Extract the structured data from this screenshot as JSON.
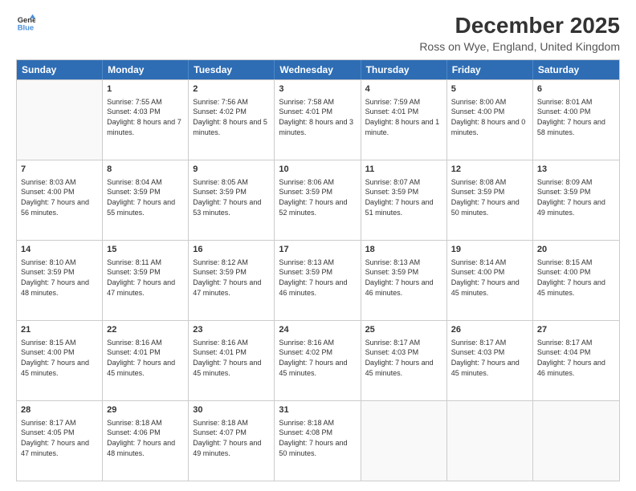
{
  "logo": {
    "line1": "General",
    "line2": "Blue"
  },
  "title": "December 2025",
  "subtitle": "Ross on Wye, England, United Kingdom",
  "header_days": [
    "Sunday",
    "Monday",
    "Tuesday",
    "Wednesday",
    "Thursday",
    "Friday",
    "Saturday"
  ],
  "weeks": [
    [
      {
        "day": "",
        "sunrise": "",
        "sunset": "",
        "daylight": ""
      },
      {
        "day": "1",
        "sunrise": "Sunrise: 7:55 AM",
        "sunset": "Sunset: 4:03 PM",
        "daylight": "Daylight: 8 hours and 7 minutes."
      },
      {
        "day": "2",
        "sunrise": "Sunrise: 7:56 AM",
        "sunset": "Sunset: 4:02 PM",
        "daylight": "Daylight: 8 hours and 5 minutes."
      },
      {
        "day": "3",
        "sunrise": "Sunrise: 7:58 AM",
        "sunset": "Sunset: 4:01 PM",
        "daylight": "Daylight: 8 hours and 3 minutes."
      },
      {
        "day": "4",
        "sunrise": "Sunrise: 7:59 AM",
        "sunset": "Sunset: 4:01 PM",
        "daylight": "Daylight: 8 hours and 1 minute."
      },
      {
        "day": "5",
        "sunrise": "Sunrise: 8:00 AM",
        "sunset": "Sunset: 4:00 PM",
        "daylight": "Daylight: 8 hours and 0 minutes."
      },
      {
        "day": "6",
        "sunrise": "Sunrise: 8:01 AM",
        "sunset": "Sunset: 4:00 PM",
        "daylight": "Daylight: 7 hours and 58 minutes."
      }
    ],
    [
      {
        "day": "7",
        "sunrise": "Sunrise: 8:03 AM",
        "sunset": "Sunset: 4:00 PM",
        "daylight": "Daylight: 7 hours and 56 minutes."
      },
      {
        "day": "8",
        "sunrise": "Sunrise: 8:04 AM",
        "sunset": "Sunset: 3:59 PM",
        "daylight": "Daylight: 7 hours and 55 minutes."
      },
      {
        "day": "9",
        "sunrise": "Sunrise: 8:05 AM",
        "sunset": "Sunset: 3:59 PM",
        "daylight": "Daylight: 7 hours and 53 minutes."
      },
      {
        "day": "10",
        "sunrise": "Sunrise: 8:06 AM",
        "sunset": "Sunset: 3:59 PM",
        "daylight": "Daylight: 7 hours and 52 minutes."
      },
      {
        "day": "11",
        "sunrise": "Sunrise: 8:07 AM",
        "sunset": "Sunset: 3:59 PM",
        "daylight": "Daylight: 7 hours and 51 minutes."
      },
      {
        "day": "12",
        "sunrise": "Sunrise: 8:08 AM",
        "sunset": "Sunset: 3:59 PM",
        "daylight": "Daylight: 7 hours and 50 minutes."
      },
      {
        "day": "13",
        "sunrise": "Sunrise: 8:09 AM",
        "sunset": "Sunset: 3:59 PM",
        "daylight": "Daylight: 7 hours and 49 minutes."
      }
    ],
    [
      {
        "day": "14",
        "sunrise": "Sunrise: 8:10 AM",
        "sunset": "Sunset: 3:59 PM",
        "daylight": "Daylight: 7 hours and 48 minutes."
      },
      {
        "day": "15",
        "sunrise": "Sunrise: 8:11 AM",
        "sunset": "Sunset: 3:59 PM",
        "daylight": "Daylight: 7 hours and 47 minutes."
      },
      {
        "day": "16",
        "sunrise": "Sunrise: 8:12 AM",
        "sunset": "Sunset: 3:59 PM",
        "daylight": "Daylight: 7 hours and 47 minutes."
      },
      {
        "day": "17",
        "sunrise": "Sunrise: 8:13 AM",
        "sunset": "Sunset: 3:59 PM",
        "daylight": "Daylight: 7 hours and 46 minutes."
      },
      {
        "day": "18",
        "sunrise": "Sunrise: 8:13 AM",
        "sunset": "Sunset: 3:59 PM",
        "daylight": "Daylight: 7 hours and 46 minutes."
      },
      {
        "day": "19",
        "sunrise": "Sunrise: 8:14 AM",
        "sunset": "Sunset: 4:00 PM",
        "daylight": "Daylight: 7 hours and 45 minutes."
      },
      {
        "day": "20",
        "sunrise": "Sunrise: 8:15 AM",
        "sunset": "Sunset: 4:00 PM",
        "daylight": "Daylight: 7 hours and 45 minutes."
      }
    ],
    [
      {
        "day": "21",
        "sunrise": "Sunrise: 8:15 AM",
        "sunset": "Sunset: 4:00 PM",
        "daylight": "Daylight: 7 hours and 45 minutes."
      },
      {
        "day": "22",
        "sunrise": "Sunrise: 8:16 AM",
        "sunset": "Sunset: 4:01 PM",
        "daylight": "Daylight: 7 hours and 45 minutes."
      },
      {
        "day": "23",
        "sunrise": "Sunrise: 8:16 AM",
        "sunset": "Sunset: 4:01 PM",
        "daylight": "Daylight: 7 hours and 45 minutes."
      },
      {
        "day": "24",
        "sunrise": "Sunrise: 8:16 AM",
        "sunset": "Sunset: 4:02 PM",
        "daylight": "Daylight: 7 hours and 45 minutes."
      },
      {
        "day": "25",
        "sunrise": "Sunrise: 8:17 AM",
        "sunset": "Sunset: 4:03 PM",
        "daylight": "Daylight: 7 hours and 45 minutes."
      },
      {
        "day": "26",
        "sunrise": "Sunrise: 8:17 AM",
        "sunset": "Sunset: 4:03 PM",
        "daylight": "Daylight: 7 hours and 45 minutes."
      },
      {
        "day": "27",
        "sunrise": "Sunrise: 8:17 AM",
        "sunset": "Sunset: 4:04 PM",
        "daylight": "Daylight: 7 hours and 46 minutes."
      }
    ],
    [
      {
        "day": "28",
        "sunrise": "Sunrise: 8:17 AM",
        "sunset": "Sunset: 4:05 PM",
        "daylight": "Daylight: 7 hours and 47 minutes."
      },
      {
        "day": "29",
        "sunrise": "Sunrise: 8:18 AM",
        "sunset": "Sunset: 4:06 PM",
        "daylight": "Daylight: 7 hours and 48 minutes."
      },
      {
        "day": "30",
        "sunrise": "Sunrise: 8:18 AM",
        "sunset": "Sunset: 4:07 PM",
        "daylight": "Daylight: 7 hours and 49 minutes."
      },
      {
        "day": "31",
        "sunrise": "Sunrise: 8:18 AM",
        "sunset": "Sunset: 4:08 PM",
        "daylight": "Daylight: 7 hours and 50 minutes."
      },
      {
        "day": "",
        "sunrise": "",
        "sunset": "",
        "daylight": ""
      },
      {
        "day": "",
        "sunrise": "",
        "sunset": "",
        "daylight": ""
      },
      {
        "day": "",
        "sunrise": "",
        "sunset": "",
        "daylight": ""
      }
    ]
  ]
}
